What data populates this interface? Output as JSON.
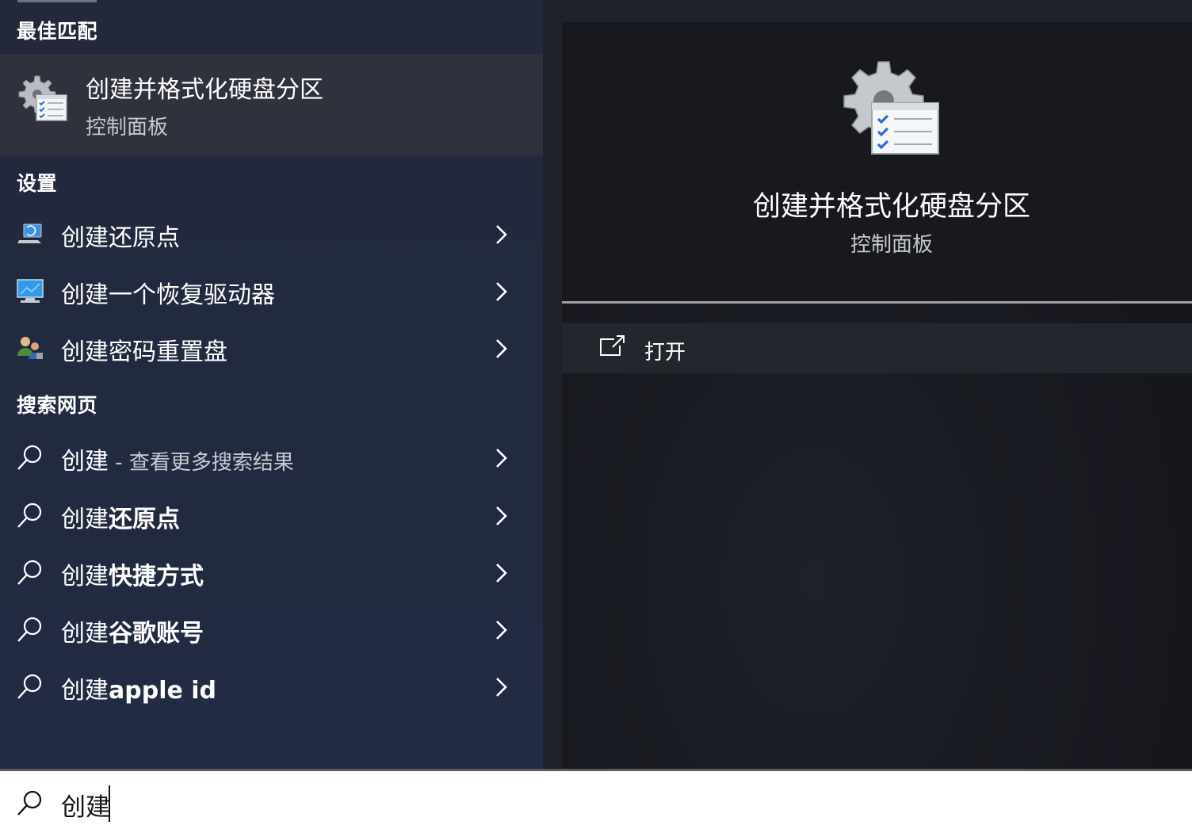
{
  "sections": {
    "best_match": "最佳匹配",
    "settings": "设置",
    "search_web": "搜索网页"
  },
  "best_match": {
    "title": "创建并格式化硬盘分区",
    "subtitle": "控制面板",
    "icon": "control-panel-gear-checklist-icon"
  },
  "settings_items": [
    {
      "label": "创建还原点",
      "icon": "restore-point-icon"
    },
    {
      "label": "创建一个恢复驱动器",
      "icon": "recovery-drive-icon"
    },
    {
      "label": "创建密码重置盘",
      "icon": "password-reset-icon"
    }
  ],
  "web_items": [
    {
      "prefix": "创建",
      "bold": "",
      "suffix": " - 查看更多搜索结果"
    },
    {
      "prefix": "创建",
      "bold": "还原点",
      "suffix": ""
    },
    {
      "prefix": "创建",
      "bold": "快捷方式",
      "suffix": ""
    },
    {
      "prefix": "创建",
      "bold": "谷歌账号",
      "suffix": ""
    },
    {
      "prefix": "创建",
      "bold": "apple id",
      "suffix": ""
    }
  ],
  "preview": {
    "title": "创建并格式化硬盘分区",
    "subtitle": "控制面板",
    "icon": "control-panel-gear-checklist-icon"
  },
  "actions": {
    "open_label": "打开",
    "open_icon": "open-external-icon"
  },
  "search": {
    "value": "创建",
    "icon": "search-icon"
  },
  "colors": {
    "left_panel": "#23283a",
    "best_match_highlight": "#2f323d",
    "right_card": "#18191f",
    "search_bar": "#ffffff"
  }
}
